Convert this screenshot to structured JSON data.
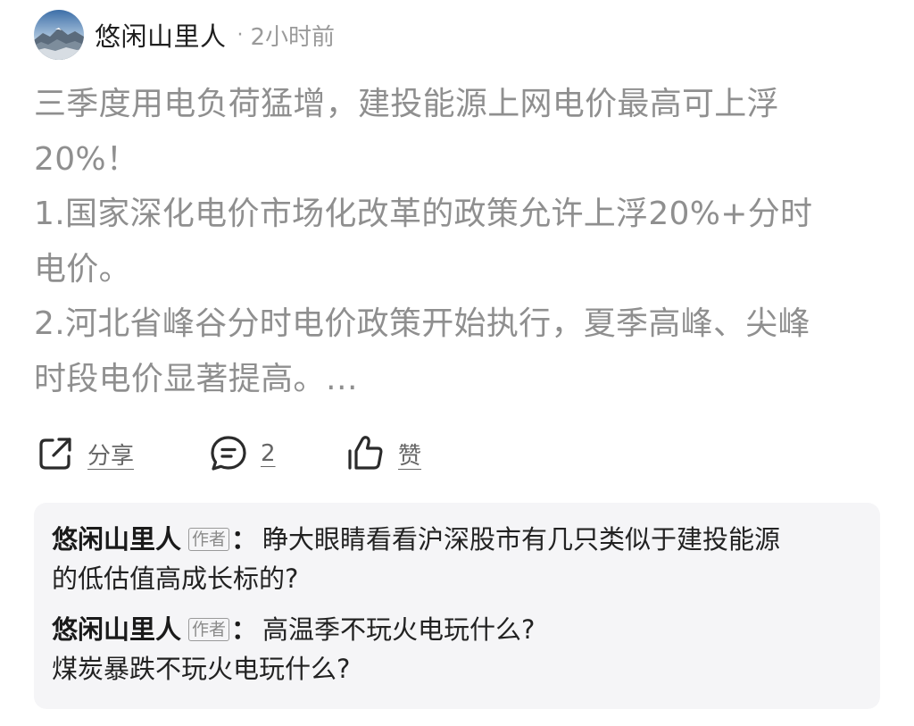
{
  "post": {
    "author": "悠闲山里人",
    "separator": "·",
    "time": "2小时前",
    "lines": [
      "三季度用电负荷猛增，建投能源上网电价最高可上浮",
      "20%！",
      "1.国家深化电价市场化改革的政策允许上浮20%+分时",
      "电价。",
      "2.河北省峰谷分时电价政策开始执行，夏季高峰、尖峰",
      "时段电价显著提高。…"
    ]
  },
  "actions": {
    "share_label": "分享",
    "comment_count": "2",
    "like_label": "赞",
    "share_icon": "share-icon",
    "comment_icon": "comment-icon",
    "like_icon": "thumbs-up-icon"
  },
  "comments": [
    {
      "author": "悠闲山里人",
      "badge": "作者",
      "colon": "：",
      "line1": "睁大眼睛看看沪深股市有几只类似于建投能源",
      "line2": "的低估值高成长标的?"
    },
    {
      "author": "悠闲山里人",
      "badge": "作者",
      "colon": "：",
      "line1": "高温季不玩火电玩什么?",
      "line2": "煤炭暴跌不玩火电玩什么?"
    }
  ],
  "colors": {
    "body_text": "#8f8f8f",
    "comment_bg": "#f5f5f7",
    "meta": "#9a9a9a"
  }
}
